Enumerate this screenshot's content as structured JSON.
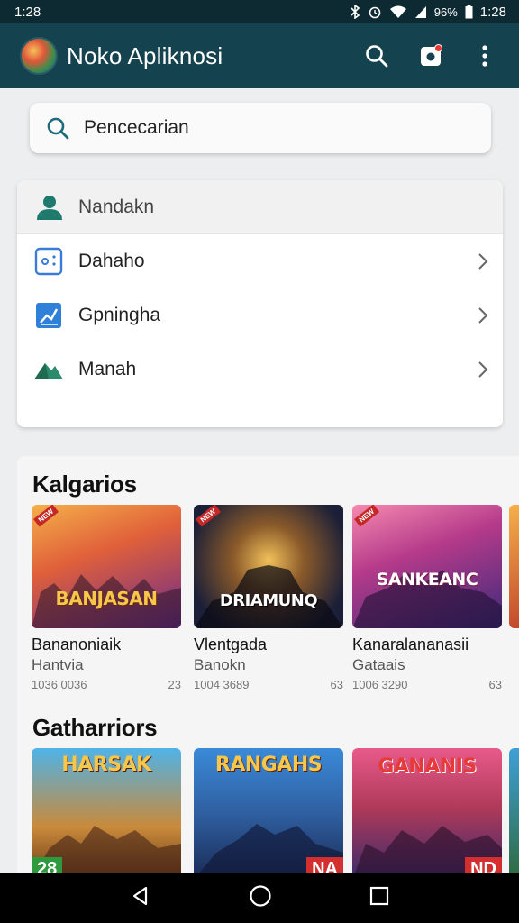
{
  "status_bar": {
    "time": "1:28",
    "battery": "96%",
    "time_right": "1:28"
  },
  "app_bar": {
    "title": "Noko Apliknosi"
  },
  "search": {
    "placeholder": "Pencecarian"
  },
  "menu": {
    "header": "Nandakn",
    "items": [
      {
        "label": "Dahaho",
        "icon": "dashboard-icon"
      },
      {
        "label": "Gpningha",
        "icon": "chart-icon"
      },
      {
        "label": "Manah",
        "icon": "home-icon"
      }
    ]
  },
  "sections": [
    {
      "title": "Kalgarios",
      "cards": [
        {
          "art": "BANJASAN",
          "name": "Bananoniaik",
          "sub": "Hantvia",
          "meta": "1036 0036",
          "rating": "23",
          "colors": [
            "#f39a3b",
            "#6a2a8c"
          ]
        },
        {
          "art": "DRIAMUNQ",
          "name": "Vlentgada",
          "sub": "Banokn",
          "meta": "1004 3689",
          "rating": "63",
          "colors": [
            "#e9b049",
            "#1b1f38"
          ]
        },
        {
          "art": "SANKEANC",
          "name": "Kanaralananasii",
          "sub": "Gataais",
          "meta": "1006 3290",
          "rating": "63",
          "colors": [
            "#e04e8a",
            "#3b2a7a"
          ]
        }
      ]
    },
    {
      "title": "Gatharriors",
      "cards": [
        {
          "art": "HARSAK",
          "badge": "28",
          "colors": [
            "#3ea0d8",
            "#c98a3a"
          ]
        },
        {
          "art": "RANGAHS",
          "badge": "NA",
          "colors": [
            "#2f6fc0",
            "#1a2a55"
          ]
        },
        {
          "art": "GANANIS",
          "badge": "ND",
          "colors": [
            "#d23c3c",
            "#3a2a6a"
          ]
        }
      ]
    }
  ],
  "nav": {
    "back": "back-icon",
    "home": "home-circle-icon",
    "recents": "recents-icon"
  }
}
